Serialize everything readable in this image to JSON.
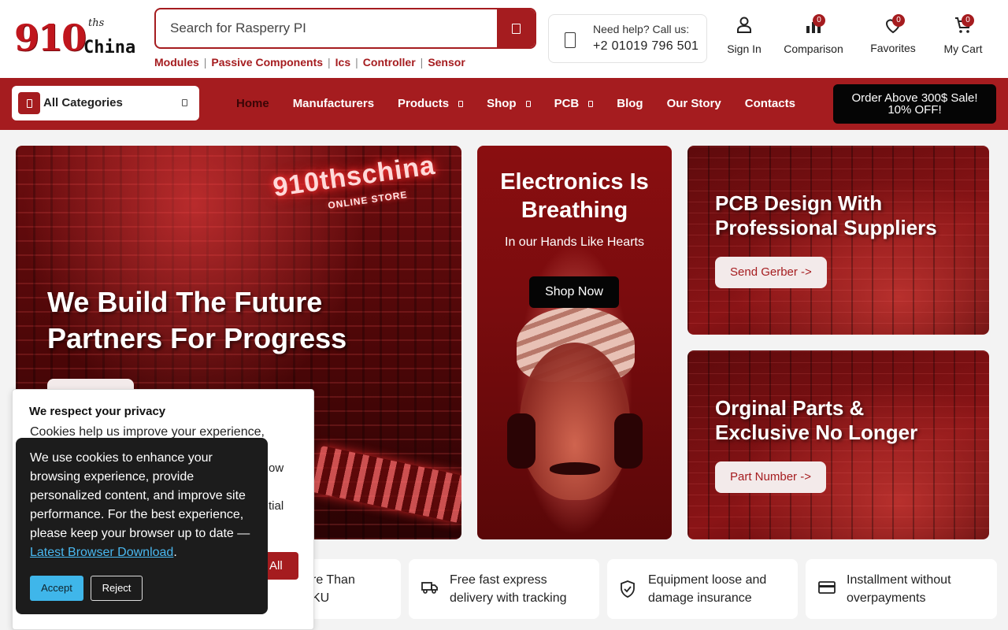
{
  "header": {
    "logo": {
      "number": "910",
      "superscript": "ths",
      "name": "China"
    },
    "search": {
      "placeholder": "Search for Rasperry PI"
    },
    "quick_links": [
      "Modules",
      "Passive Components",
      "Ics",
      "Controller",
      "Sensor"
    ],
    "help": {
      "label": "Need help? Call us:",
      "phone": "+2 01019 796 501"
    },
    "actions": {
      "sign_in": "Sign In",
      "comparison": {
        "label": "Comparison",
        "count": "0"
      },
      "favorites": {
        "label": "Favorites",
        "count": "0"
      },
      "cart": {
        "label": "My Cart",
        "count": "0"
      }
    }
  },
  "nav": {
    "categories_label": "All Categories",
    "items": [
      "Home",
      "Manufacturers",
      "Products",
      "Shop",
      "PCB",
      "Blog",
      "Our Story",
      "Contacts"
    ],
    "promo": {
      "line1": "Order Above 300$ Sale!",
      "line2": "10% OFF!"
    }
  },
  "hero": {
    "main": {
      "neon_title": "910thschina",
      "neon_sub": "ONLINE STORE",
      "line1": "We Build The Future",
      "line2": "Partners For Progress"
    },
    "middle": {
      "line1": "Electronics Is",
      "line2": "Breathing",
      "subtitle": "In our Hands Like Hearts",
      "button": "Shop Now"
    },
    "top_right": {
      "line1": "PCB Design With",
      "line2": "Professional Suppliers",
      "button": "Send Gerber ->"
    },
    "bottom_right": {
      "line1": "Orginal Parts &",
      "line2": "Exclusive No Longer",
      "button": "Part Number ->"
    }
  },
  "features": [
    {
      "line1": "re Than",
      "line2": "KU"
    },
    {
      "line1": "Free fast express",
      "line2": "delivery with tracking"
    },
    {
      "line1": "Equipment loose and",
      "line2": "damage insurance"
    },
    {
      "line1": "Installment without",
      "line2": "overpayments"
    }
  ],
  "privacy_panel": {
    "title": "We respect your privacy",
    "body": "Cookies help us improve your experience,",
    "frag1": "ow",
    "frag2": "tial",
    "button_fragment": "All"
  },
  "cookie_banner": {
    "message": "We use cookies to enhance your browsing experience, provide personalized content, and improve site performance. For the best experience, please keep your browser up to date —",
    "link": "Latest Browser Download",
    "period": ".",
    "accept": "Accept",
    "reject": "Reject"
  },
  "colors": {
    "brand": "#a51c1f",
    "dark": "#050505",
    "link": "#49b8f0",
    "accept": "#3fb6ea"
  }
}
